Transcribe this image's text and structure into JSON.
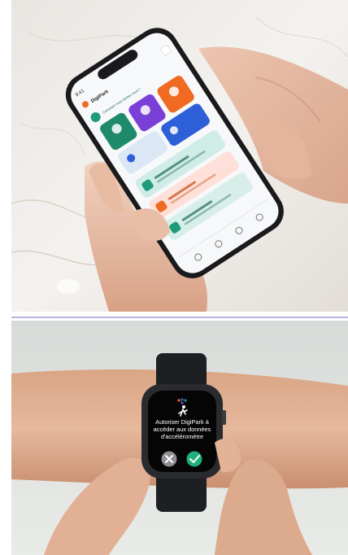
{
  "phone_photo": {
    "app": {
      "status_time": "9:41",
      "app_name": "DigiPark",
      "question": "Comment vous sentez-vous ?",
      "tiles": [
        {
          "color": "#1f8a6a",
          "icon": "walk-icon"
        },
        {
          "color": "#7a3fd6",
          "icon": "apple-icon"
        },
        {
          "color": "#f06a22",
          "icon": "timer-icon"
        },
        {
          "color": "#2d5fd8",
          "icon": "medication-icon"
        },
        {
          "color": "#dbe7f5",
          "icon": "moon-icon"
        }
      ],
      "cards": [
        {
          "color": "#cfece6",
          "icon_color": "#1f9a7a"
        },
        {
          "color": "#ffe0d8",
          "icon_color": "#f06a22"
        },
        {
          "color": "#d8efe9",
          "icon_color": "#1f9a7a"
        }
      ]
    }
  },
  "watch_photo": {
    "watch_screen": {
      "title": "Autoriser DigiPark à accéder aux données d'accéléromètre",
      "decline_icon": "close-icon",
      "accept_icon": "check-icon",
      "accept_color": "#22b07a",
      "decline_color": "#8e8e93"
    }
  }
}
